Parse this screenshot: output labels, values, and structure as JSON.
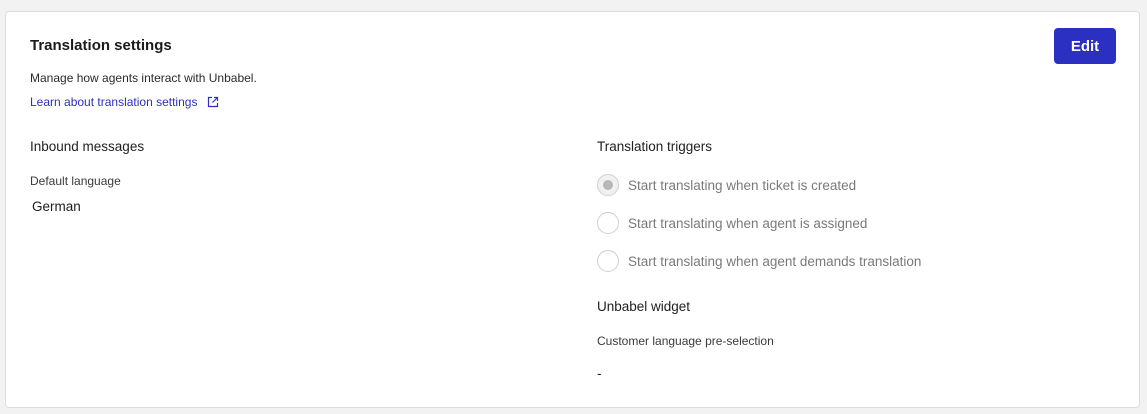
{
  "header": {
    "title": "Translation settings",
    "edit_label": "Edit",
    "description": "Manage how agents interact with Unbabel.",
    "learn_link": "Learn about translation settings"
  },
  "inbound": {
    "title": "Inbound messages",
    "default_language_label": "Default language",
    "default_language_value": "German"
  },
  "triggers": {
    "title": "Translation triggers",
    "options": [
      {
        "label": "Start translating when ticket is created",
        "selected": true
      },
      {
        "label": "Start translating when agent is assigned",
        "selected": false
      },
      {
        "label": "Start translating when agent demands translation",
        "selected": false
      }
    ]
  },
  "widget": {
    "title": "Unbabel widget",
    "preselection_label": "Customer language pre-selection",
    "preselection_value": "-"
  },
  "colors": {
    "accent": "#2b2fc2",
    "background": "#f2f2f2",
    "card": "#ffffff"
  }
}
